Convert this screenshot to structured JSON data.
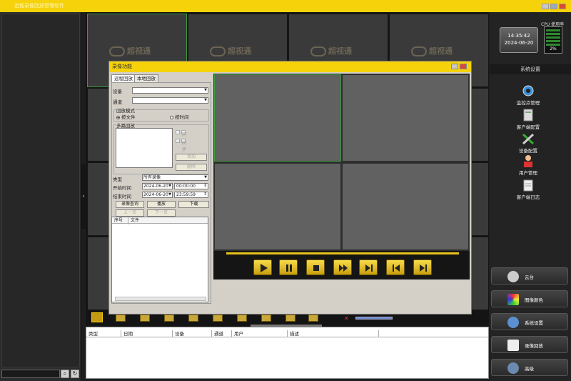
{
  "app": {
    "title": "远程录像回放管理软件"
  },
  "left": {
    "search_placeholder": ""
  },
  "watermark": "超视通",
  "clock": {
    "time": "14:35:42",
    "date": "2024-06-20"
  },
  "cpu": {
    "label": "CPU 使用率",
    "value": "2%"
  },
  "right_panel": {
    "header": "系统设置",
    "quick_items": [
      {
        "label": "监控点管理",
        "icon": "camera-icon"
      },
      {
        "label": "客户端配置",
        "icon": "server-config-icon"
      },
      {
        "label": "设备配置",
        "icon": "tools-icon"
      },
      {
        "label": "用户管理",
        "icon": "user-icon"
      },
      {
        "label": "客户端日志",
        "icon": "log-icon"
      }
    ],
    "big_buttons": [
      {
        "label": "云台",
        "icon": "ptz-icon"
      },
      {
        "label": "图像颜色",
        "icon": "color-icon"
      },
      {
        "label": "系统设置",
        "icon": "settings-icon"
      },
      {
        "label": "录像回放",
        "icon": "film-icon"
      },
      {
        "label": "高级",
        "icon": "users-icon"
      }
    ]
  },
  "log": {
    "columns": [
      "类型",
      "日期",
      "设备",
      "通道",
      "用户",
      "描述"
    ]
  },
  "dialog": {
    "title": "录像功能",
    "tabs": [
      "远程回放",
      "本地回放"
    ],
    "device_label": "设备",
    "channel_label": "通道",
    "device_value": "",
    "channel_value": "",
    "mode_group": "回放模式",
    "mode_options": [
      "按文件",
      "按时间"
    ],
    "multi_group": "多路回放",
    "multi_checks": [
      "同步",
      "同步"
    ],
    "add_label": "添加",
    "delete_label": "删除",
    "type_label": "类型",
    "type_value": "所有录像",
    "start_label": "开始时间",
    "end_label": "结束时间",
    "start_date": "2024-06-20",
    "start_time": "00:00:00",
    "end_date": "2024-06-20",
    "end_time": "23:59:59",
    "query_label": "录像查询",
    "play_label": "播放",
    "download_label": "下载",
    "prev_label": "上一页",
    "next_label": "下一页",
    "list_columns": [
      "序号",
      "文件"
    ]
  },
  "colors": {
    "accent": "#f5d20a",
    "selected_border": "#3d9a3d"
  }
}
